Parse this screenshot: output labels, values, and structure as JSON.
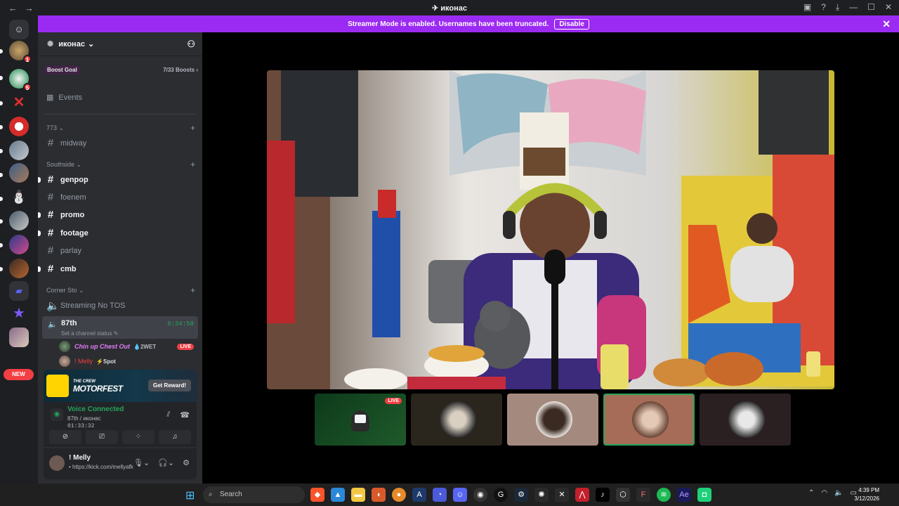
{
  "window": {
    "title": "иконас",
    "back": "←",
    "forward": "→",
    "right_icons": [
      "inbox-icon",
      "help-icon",
      "download-icon",
      "minimize-icon",
      "maximize-icon",
      "close-icon"
    ]
  },
  "guilds": {
    "new_label": "NEW",
    "badges": [
      "1",
      "5"
    ]
  },
  "banner": {
    "text": "Streamer Mode is enabled. Usernames have been truncated.",
    "disable": "Disable",
    "close": "✕"
  },
  "server": {
    "name": "иконас",
    "chevron": "⌄"
  },
  "boost": {
    "label": "Boost Goal",
    "count": "7/33 Boosts",
    "arrow": "›"
  },
  "events": {
    "label": "Events"
  },
  "categories": [
    {
      "name": "773 ⌄"
    },
    {
      "name": "Southside ⌄"
    },
    {
      "name": "Corner Sto ⌄"
    }
  ],
  "channels": {
    "midway": "midway",
    "genpop": "genpop",
    "foenem": "foenem",
    "promo": "promo",
    "footage": "footage",
    "parlay": "parlay",
    "cmb": "cmb",
    "streaming": "Streaming No TOS"
  },
  "active_voice": {
    "name": "87th",
    "time": "6:34:58",
    "status": "Set a channel status ✎"
  },
  "voice_users": [
    {
      "name": "Chin up Chest Out",
      "tag": "💧2WET",
      "live": "LIVE",
      "color": "#e27cf9"
    },
    {
      "name": "! Melly",
      "tag": "⚡Spot",
      "color": "#f23f43"
    }
  ],
  "promo": {
    "game_line1": "THE CREW",
    "game_line2": "MOTORFEST",
    "button": "Get Reward!"
  },
  "voice_panel": {
    "title": "Voice Connected",
    "sub": "87th / иконас",
    "duration": "01:33:32"
  },
  "user": {
    "name": "! Melly",
    "status": "• https://kick.com/mellyafk"
  },
  "tiles": {
    "live": "LIVE"
  },
  "taskbar": {
    "search": "Search",
    "time": "4:39 PM",
    "date": "3/12/2026"
  },
  "colors": {
    "accent": "#9b2bf2",
    "green": "#23a55a",
    "red": "#f23f43",
    "sidebar": "#2b2d31"
  }
}
